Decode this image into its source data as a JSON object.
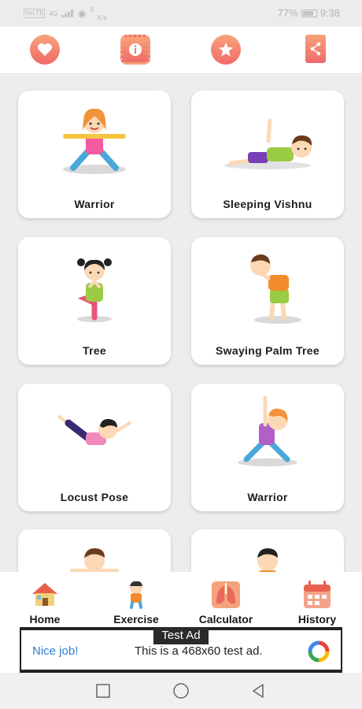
{
  "status_bar": {
    "sim_label": "VoLTE",
    "network": "4G",
    "speed": "0",
    "speed_unit": "K/s",
    "battery": "77%",
    "time": "9:38"
  },
  "header": {
    "icons": [
      "heart-icon",
      "info-gear-icon",
      "star-icon",
      "share-icon"
    ]
  },
  "poses": [
    {
      "label": "Warrior"
    },
    {
      "label": "Sleeping Vishnu"
    },
    {
      "label": "Tree"
    },
    {
      "label": "Swaying Palm Tree"
    },
    {
      "label": "Locust Pose"
    },
    {
      "label": "Warrior"
    },
    {
      "label": ""
    },
    {
      "label": ""
    }
  ],
  "bottom_nav": {
    "items": [
      {
        "label": "Home",
        "icon": "house-icon"
      },
      {
        "label": "Exercise",
        "icon": "exercise-kid-icon"
      },
      {
        "label": "Calculator",
        "icon": "lungs-icon"
      },
      {
        "label": "History",
        "icon": "calendar-icon"
      }
    ]
  },
  "ad": {
    "tag": "Test Ad",
    "nice": "Nice job!",
    "text": "This is a 468x60 test ad."
  },
  "colors": {
    "accent_top": "#f8a27a",
    "accent_bottom": "#f06a6a",
    "ad_link": "#2f7cd5"
  }
}
